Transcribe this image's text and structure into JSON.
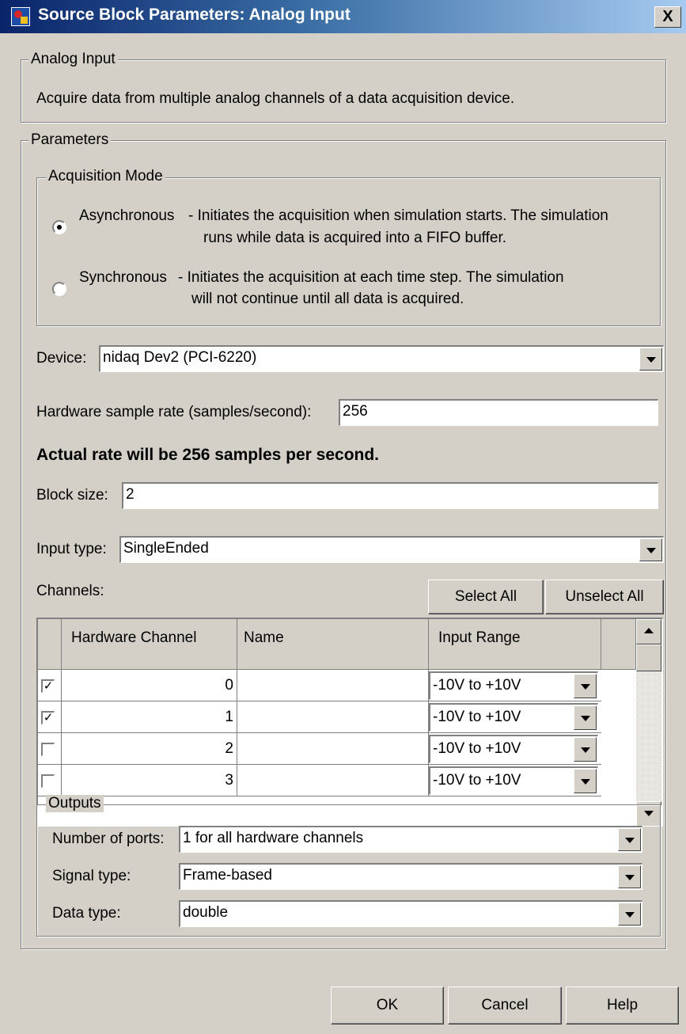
{
  "window": {
    "title": "Source Block Parameters: Analog Input",
    "close_label": "X"
  },
  "description_group": {
    "title": "Analog Input",
    "text": "Acquire data from multiple analog channels of a data acquisition device."
  },
  "parameters": {
    "title": "Parameters",
    "acquisition_mode": {
      "title": "Acquisition Mode",
      "options": [
        {
          "label": "Asynchronous",
          "desc1": "- Initiates the acquisition when simulation starts. The simulation",
          "desc2": "runs while data is acquired into a FIFO buffer.",
          "selected": true
        },
        {
          "label": "Synchronous",
          "desc1": "- Initiates the acquisition at each time step. The simulation",
          "desc2": "will not continue until all data is acquired.",
          "selected": false
        }
      ]
    },
    "device": {
      "label": "Device:",
      "value": "nidaq Dev2 (PCI-6220)"
    },
    "sample_rate": {
      "label": "Hardware sample rate (samples/second):",
      "value": "256"
    },
    "actual_rate_note": "Actual rate will be 256 samples per second.",
    "block_size": {
      "label": "Block size:",
      "value": "2"
    },
    "input_type": {
      "label": "Input type:",
      "value": "SingleEnded"
    },
    "channels": {
      "label": "Channels:",
      "select_all": "Select All",
      "unselect_all": "Unselect All",
      "columns": [
        "Hardware Channel",
        "Name",
        "Input Range"
      ],
      "rows": [
        {
          "checked": true,
          "channel": "0",
          "name": "",
          "range": "-10V to +10V"
        },
        {
          "checked": true,
          "channel": "1",
          "name": "",
          "range": "-10V to +10V"
        },
        {
          "checked": false,
          "channel": "2",
          "name": "",
          "range": "-10V to +10V"
        },
        {
          "checked": false,
          "channel": "3",
          "name": "",
          "range": "-10V to +10V"
        }
      ]
    },
    "outputs": {
      "title": "Outputs",
      "ports": {
        "label": "Number of ports:",
        "value": "1 for all hardware channels"
      },
      "signal_type": {
        "label": "Signal type:",
        "value": "Frame-based"
      },
      "data_type": {
        "label": "Data type:",
        "value": "double"
      }
    }
  },
  "buttons": {
    "ok": "OK",
    "cancel": "Cancel",
    "help": "Help"
  },
  "colors": {
    "face": "#d4d0c8",
    "title_start": "#0a246a",
    "title_end": "#a6caf0"
  },
  "icons": [
    "simulink-block-icon",
    "close-icon",
    "radio-icon",
    "dropdown-arrow-icon",
    "checkbox-icon",
    "scroll-up-icon",
    "scroll-down-icon"
  ]
}
